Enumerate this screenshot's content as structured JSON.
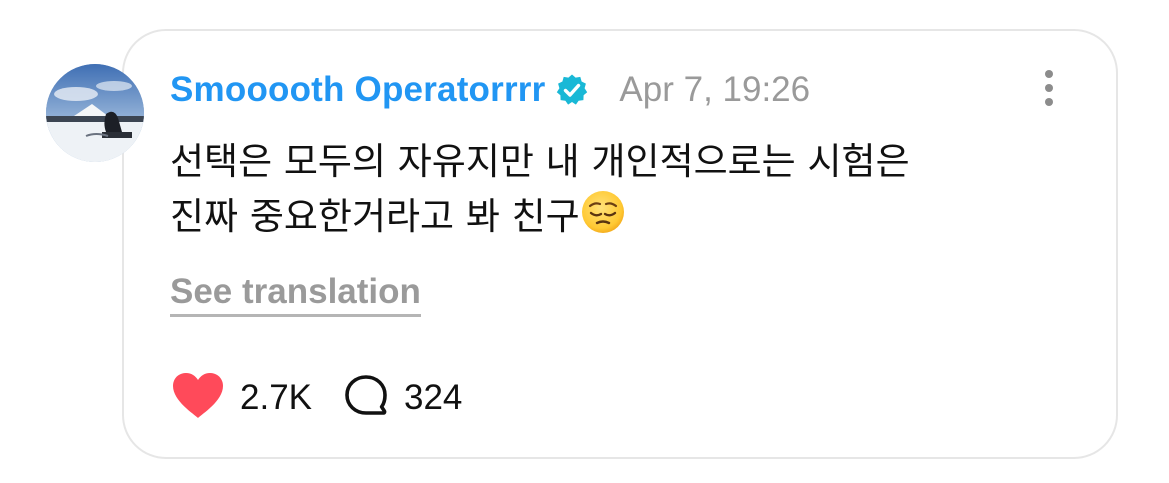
{
  "post": {
    "author": {
      "name": "Smooooth Operatorrrr",
      "verified": true,
      "avatar": "avatar-snow-landscape"
    },
    "timestamp": "Apr 7, 19:26",
    "text_lines": [
      "선택은 모두의 자유지만 내 개인적으로는 시험은",
      "진짜 중요한거라고 봐 친구"
    ],
    "emoji": "pensive-face-emoji",
    "see_translation_label": "See translation",
    "likes": "2.7K",
    "replies": "324"
  },
  "icons": {
    "verified": "verified-badge-icon",
    "more": "more-vertical-icon",
    "like": "heart-icon",
    "reply": "speech-bubble-icon"
  },
  "colors": {
    "username": "#2196f3",
    "verified_badge": "#19b8d6",
    "heart": "#ff4a5a",
    "muted": "#9a9a9a"
  }
}
